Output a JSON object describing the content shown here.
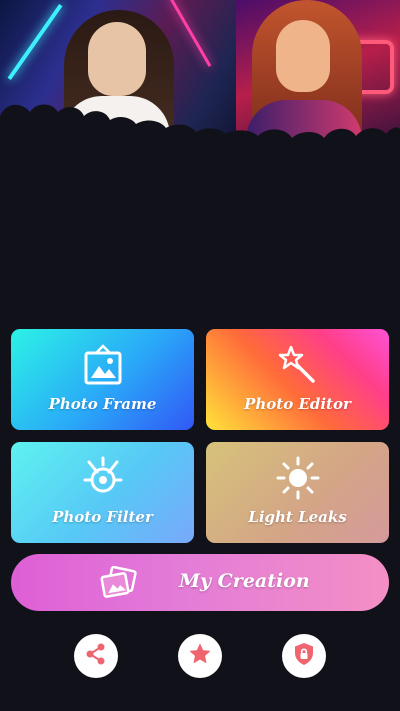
{
  "header": {
    "banner_left_photo": "photo-portrait-woman-neon",
    "banner_right_photo": "photo-portrait-woman-neon-sign"
  },
  "menu": {
    "tiles": [
      {
        "label": "Photo Frame",
        "icon": "frame-icon"
      },
      {
        "label": "Photo Editor",
        "icon": "magic-wand-icon"
      },
      {
        "label": "Photo Filter",
        "icon": "filter-icon"
      },
      {
        "label": "Light Leaks",
        "icon": "sun-icon"
      }
    ],
    "creation": {
      "label": "My Creation",
      "icon": "photos-stack-icon"
    }
  },
  "footer": {
    "buttons": [
      {
        "icon": "share-icon"
      },
      {
        "icon": "star-icon"
      },
      {
        "icon": "lock-shield-icon"
      }
    ]
  },
  "colors": {
    "background": "#111119",
    "icon_accent": "#f06470",
    "tile_frame": "#2aa8f8",
    "tile_editor": "#ff6a3a",
    "tile_filter": "#57c8f6",
    "tile_leaks": "#d4a487",
    "creation": "#e37cd7"
  }
}
